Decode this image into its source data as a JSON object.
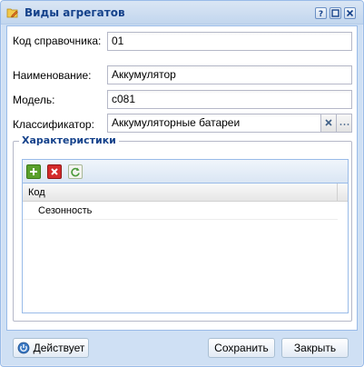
{
  "window": {
    "title": "Виды агрегатов",
    "icon": "folder-edit-icon"
  },
  "form": {
    "code": {
      "label": "Код справочника:",
      "value": "01"
    },
    "name": {
      "label": "Наименование:",
      "value": "Аккумулятор"
    },
    "model": {
      "label": "Модель:",
      "value": "c081"
    },
    "classifier": {
      "label": "Классификатор:",
      "value": "Аккумуляторные батареи",
      "more_label": "..."
    }
  },
  "characteristics": {
    "legend": "Характеристики",
    "columns": [
      "Код"
    ],
    "rows": [
      [
        "Сезонность"
      ]
    ]
  },
  "footer": {
    "status_label": "Действует",
    "save_label": "Сохранить",
    "close_label": "Закрыть"
  },
  "colors": {
    "accent": "#15428b",
    "add": "#5aa02c",
    "delete": "#d42b2b",
    "refresh": "#4a9a3a"
  }
}
